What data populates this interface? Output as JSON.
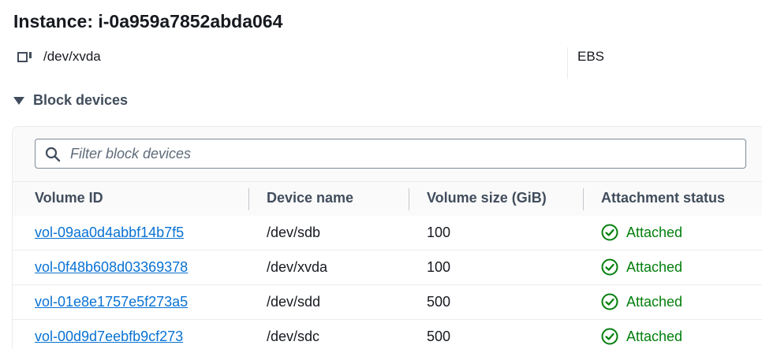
{
  "instance": {
    "title": "Instance: i-0a959a7852abda064"
  },
  "root_device": {
    "icon": "volume-icon",
    "device_name": "/dev/xvda",
    "device_type": "EBS"
  },
  "block_devices": {
    "section_title": "Block devices",
    "filter_placeholder": "Filter block devices",
    "filter_value": "",
    "columns": [
      "Volume ID",
      "Device name",
      "Volume size (GiB)",
      "Attachment status"
    ],
    "rows": [
      {
        "volume_id": "vol-09aa0d4abbf14b7f5",
        "device_name": "/dev/sdb",
        "size": "100",
        "status": "Attached"
      },
      {
        "volume_id": "vol-0f48b608d03369378",
        "device_name": "/dev/xvda",
        "size": "100",
        "status": "Attached"
      },
      {
        "volume_id": "vol-01e8e1757e5f273a5",
        "device_name": "/dev/sdd",
        "size": "500",
        "status": "Attached"
      },
      {
        "volume_id": "vol-00d9d7eebfb9cf273",
        "device_name": "/dev/sdc",
        "size": "500",
        "status": "Attached"
      }
    ]
  },
  "colors": {
    "link": "#0972d3",
    "success": "#037f0c",
    "header_text": "#414d5c",
    "border": "#e9ebed"
  }
}
